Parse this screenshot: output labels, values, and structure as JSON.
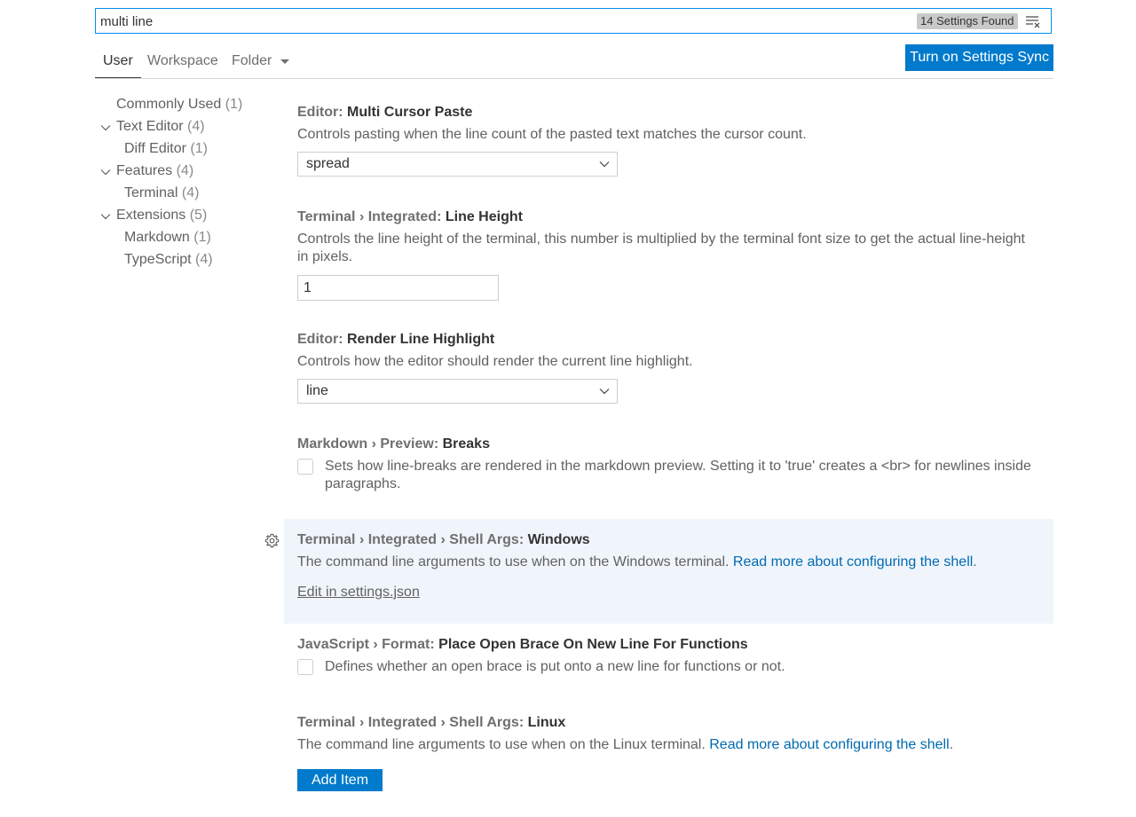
{
  "search": {
    "value": "multi line",
    "results_count": "14 Settings Found",
    "clear_icon": "clear-filter-icon"
  },
  "tabs": [
    {
      "label": "User",
      "active": true
    },
    {
      "label": "Workspace",
      "active": false
    },
    {
      "label": "Folder",
      "active": false
    }
  ],
  "sync_button": "Turn on Settings Sync",
  "toc": [
    {
      "label": "Commonly Used",
      "count": "(1)",
      "expanded": null
    },
    {
      "label": "Text Editor",
      "count": "(4)",
      "expanded": true
    },
    {
      "label": "Diff Editor",
      "count": "(1)",
      "expanded": null
    },
    {
      "label": "Features",
      "count": "(4)",
      "expanded": true
    },
    {
      "label": "Terminal",
      "count": "(4)",
      "expanded": null
    },
    {
      "label": "Extensions",
      "count": "(5)",
      "expanded": true
    },
    {
      "label": "Markdown",
      "count": "(1)",
      "expanded": null
    },
    {
      "label": "TypeScript",
      "count": "(4)",
      "expanded": null
    }
  ],
  "settings": {
    "multi_cursor_paste": {
      "category": "Editor: ",
      "label": "Multi Cursor Paste",
      "description": "Controls pasting when the line count of the pasted text matches the cursor count.",
      "value": "spread"
    },
    "line_height": {
      "category": "Terminal › Integrated: ",
      "label": "Line Height",
      "description": "Controls the line height of the terminal, this number is multiplied by the terminal font size to get the actual line-height in pixels.",
      "value": "1"
    },
    "render_line_highlight": {
      "category": "Editor: ",
      "label": "Render Line Highlight",
      "description": "Controls how the editor should render the current line highlight.",
      "value": "line"
    },
    "markdown_breaks": {
      "category": "Markdown › Preview: ",
      "label": "Breaks",
      "description": "Sets how line-breaks are rendered in the markdown preview. Setting it to 'true' creates a <br> for newlines inside paragraphs.",
      "checked": false
    },
    "shell_args_windows": {
      "category": "Terminal › Integrated › Shell Args: ",
      "label": "Windows",
      "description": "The command line arguments to use when on the Windows terminal. ",
      "link": "Read more about configuring the shell",
      "link_suffix": ".",
      "edit_link": "Edit in settings.json"
    },
    "open_brace": {
      "category": "JavaScript › Format: ",
      "label": "Place Open Brace On New Line For Functions",
      "description": "Defines whether an open brace is put onto a new line for functions or not.",
      "checked": false
    },
    "shell_args_linux": {
      "category": "Terminal › Integrated › Shell Args: ",
      "label": "Linux",
      "description": "The command line arguments to use when on the Linux terminal. ",
      "link": "Read more about configuring the shell",
      "link_suffix": ".",
      "add_button": "Add Item"
    }
  },
  "colors": {
    "accent": "#007acc",
    "link": "#006ab1",
    "focus_row": "#f0f5fc"
  }
}
